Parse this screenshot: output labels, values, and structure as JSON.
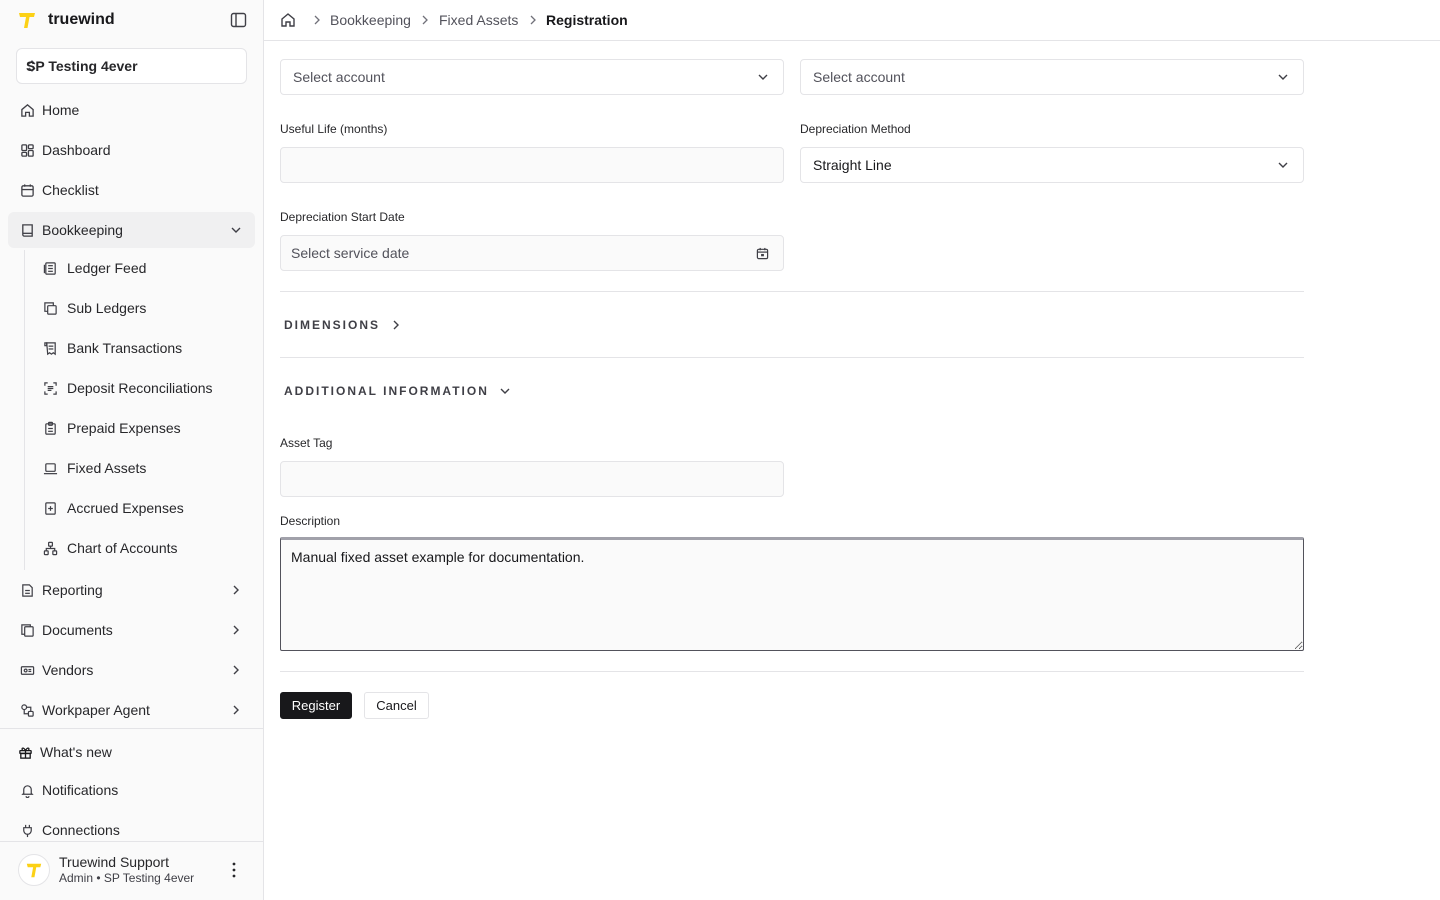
{
  "brand": {
    "name": "truewind",
    "accent": "#fcd116"
  },
  "org": {
    "name": "SP Testing 4ever"
  },
  "sidebar": {
    "items": [
      {
        "label": "Home",
        "icon": "home-icon"
      },
      {
        "label": "Dashboard",
        "icon": "dashboard-icon"
      },
      {
        "label": "Checklist",
        "icon": "calendar-icon"
      },
      {
        "label": "Bookkeeping",
        "icon": "book-icon",
        "expanded": true
      },
      {
        "label": "Reporting",
        "icon": "report-icon"
      },
      {
        "label": "Documents",
        "icon": "documents-icon"
      },
      {
        "label": "Vendors",
        "icon": "vendors-icon"
      },
      {
        "label": "Workpaper Agent",
        "icon": "workpaper-icon"
      }
    ],
    "sub_items": [
      {
        "label": "Ledger Feed",
        "icon": "ledger-icon"
      },
      {
        "label": "Sub Ledgers",
        "icon": "copy-icon"
      },
      {
        "label": "Bank Transactions",
        "icon": "receipt-icon"
      },
      {
        "label": "Deposit Reconciliations",
        "icon": "scan-icon"
      },
      {
        "label": "Prepaid Expenses",
        "icon": "clipboard-icon"
      },
      {
        "label": "Fixed Assets",
        "icon": "laptop-icon"
      },
      {
        "label": "Accrued Expenses",
        "icon": "plus-square-icon"
      },
      {
        "label": "Chart of Accounts",
        "icon": "hierarchy-icon"
      }
    ],
    "footer_items": [
      {
        "label": "What's new",
        "icon": "gift-icon"
      },
      {
        "label": "Notifications",
        "icon": "bell-icon"
      },
      {
        "label": "Connections",
        "icon": "plug-icon"
      }
    ],
    "user": {
      "name": "Truewind Support",
      "role": "Admin • SP Testing 4ever"
    }
  },
  "breadcrumb": [
    "Bookkeeping",
    "Fixed Assets",
    "Registration"
  ],
  "form": {
    "account_1": {
      "placeholder": "Select account"
    },
    "account_2": {
      "placeholder": "Select account"
    },
    "useful_life": {
      "label": "Useful Life (months)",
      "value": ""
    },
    "depreciation_method": {
      "label": "Depreciation Method",
      "value": "Straight Line"
    },
    "start_date": {
      "label": "Depreciation Start Date",
      "placeholder": "Select service date"
    },
    "dimensions_label": "DIMENSIONS",
    "additional_info_label": "ADDITIONAL INFORMATION",
    "asset_tag": {
      "label": "Asset Tag",
      "value": ""
    },
    "description": {
      "label": "Description",
      "value": "Manual fixed asset example for documentation."
    },
    "register_label": "Register",
    "cancel_label": "Cancel"
  }
}
